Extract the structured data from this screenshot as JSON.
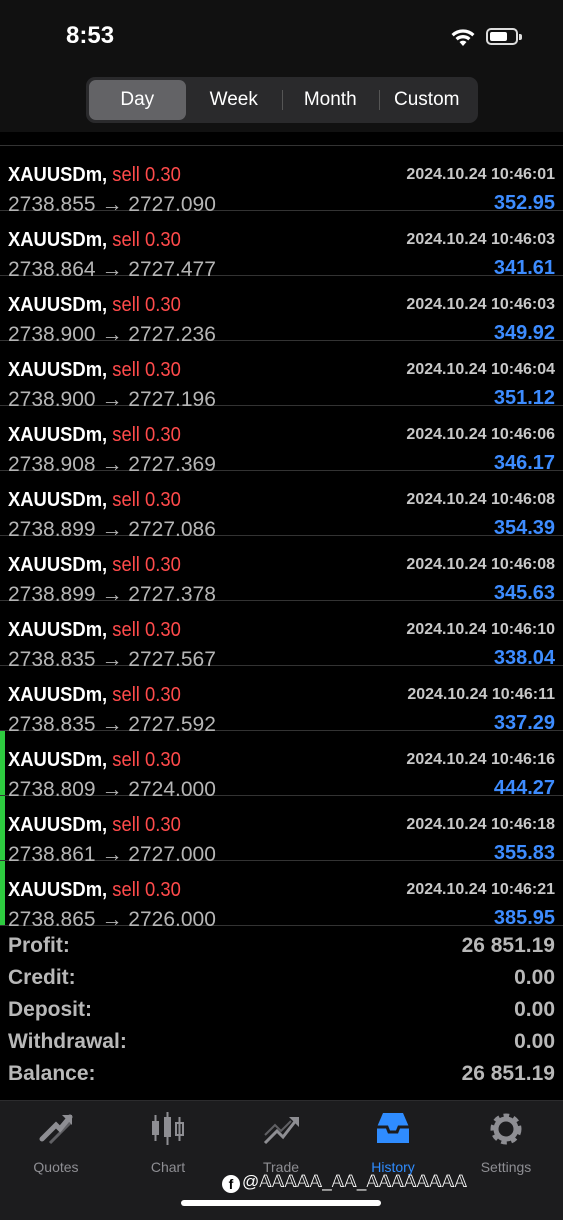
{
  "status_bar": {
    "time": "8:53"
  },
  "period_tabs": [
    {
      "label": "Day",
      "active": true
    },
    {
      "label": "Week",
      "active": false
    },
    {
      "label": "Month",
      "active": false
    },
    {
      "label": "Custom",
      "active": false
    }
  ],
  "deals": [
    {
      "symbol": "XAUUSDm,",
      "side": "sell",
      "volume": "0.30",
      "open_price": "2738.855",
      "close_price": "2727.090",
      "datetime": "2024.10.24 10:46:01",
      "profit": "352.95",
      "stripe": false
    },
    {
      "symbol": "XAUUSDm,",
      "side": "sell",
      "volume": "0.30",
      "open_price": "2738.864",
      "close_price": "2727.477",
      "datetime": "2024.10.24 10:46:03",
      "profit": "341.61",
      "stripe": false
    },
    {
      "symbol": "XAUUSDm,",
      "side": "sell",
      "volume": "0.30",
      "open_price": "2738.900",
      "close_price": "2727.236",
      "datetime": "2024.10.24 10:46:03",
      "profit": "349.92",
      "stripe": false
    },
    {
      "symbol": "XAUUSDm,",
      "side": "sell",
      "volume": "0.30",
      "open_price": "2738.900",
      "close_price": "2727.196",
      "datetime": "2024.10.24 10:46:04",
      "profit": "351.12",
      "stripe": false
    },
    {
      "symbol": "XAUUSDm,",
      "side": "sell",
      "volume": "0.30",
      "open_price": "2738.908",
      "close_price": "2727.369",
      "datetime": "2024.10.24 10:46:06",
      "profit": "346.17",
      "stripe": false
    },
    {
      "symbol": "XAUUSDm,",
      "side": "sell",
      "volume": "0.30",
      "open_price": "2738.899",
      "close_price": "2727.086",
      "datetime": "2024.10.24 10:46:08",
      "profit": "354.39",
      "stripe": false
    },
    {
      "symbol": "XAUUSDm,",
      "side": "sell",
      "volume": "0.30",
      "open_price": "2738.899",
      "close_price": "2727.378",
      "datetime": "2024.10.24 10:46:08",
      "profit": "345.63",
      "stripe": false
    },
    {
      "symbol": "XAUUSDm,",
      "side": "sell",
      "volume": "0.30",
      "open_price": "2738.835",
      "close_price": "2727.567",
      "datetime": "2024.10.24 10:46:10",
      "profit": "338.04",
      "stripe": false
    },
    {
      "symbol": "XAUUSDm,",
      "side": "sell",
      "volume": "0.30",
      "open_price": "2738.835",
      "close_price": "2727.592",
      "datetime": "2024.10.24 10:46:11",
      "profit": "337.29",
      "stripe": false
    },
    {
      "symbol": "XAUUSDm,",
      "side": "sell",
      "volume": "0.30",
      "open_price": "2738.809",
      "close_price": "2724.000",
      "datetime": "2024.10.24 10:46:16",
      "profit": "444.27",
      "stripe": true
    },
    {
      "symbol": "XAUUSDm,",
      "side": "sell",
      "volume": "0.30",
      "open_price": "2738.861",
      "close_price": "2727.000",
      "datetime": "2024.10.24 10:46:18",
      "profit": "355.83",
      "stripe": true
    },
    {
      "symbol": "XAUUSDm,",
      "side": "sell",
      "volume": "0.30",
      "open_price": "2738.865",
      "close_price": "2726.000",
      "datetime": "2024.10.24 10:46:21",
      "profit": "385.95",
      "stripe": true
    }
  ],
  "arrow": "→",
  "summary": [
    {
      "label": "Profit:",
      "value": "26 851.19"
    },
    {
      "label": "Credit:",
      "value": "0.00"
    },
    {
      "label": "Deposit:",
      "value": "0.00"
    },
    {
      "label": "Withdrawal:",
      "value": "0.00"
    },
    {
      "label": "Balance:",
      "value": "26 851.19"
    }
  ],
  "tabs": [
    {
      "label": "Quotes",
      "icon": "quotes-icon",
      "active": false
    },
    {
      "label": "Chart",
      "icon": "chart-icon",
      "active": false
    },
    {
      "label": "Trade",
      "icon": "trade-icon",
      "active": false
    },
    {
      "label": "History",
      "icon": "history-icon",
      "active": true
    },
    {
      "label": "Settings",
      "icon": "settings-icon",
      "active": false
    }
  ],
  "watermark": "@𝔸𝔸𝔸𝔸𝔸_𝔸𝔸_𝔸𝔸𝔸𝔸𝔸𝔸𝔸𝔸",
  "colors": {
    "sell": "#ff4b4b",
    "profit": "#3d8cff",
    "active_tab": "#2f8cff",
    "stripe": "#2ecc40"
  }
}
